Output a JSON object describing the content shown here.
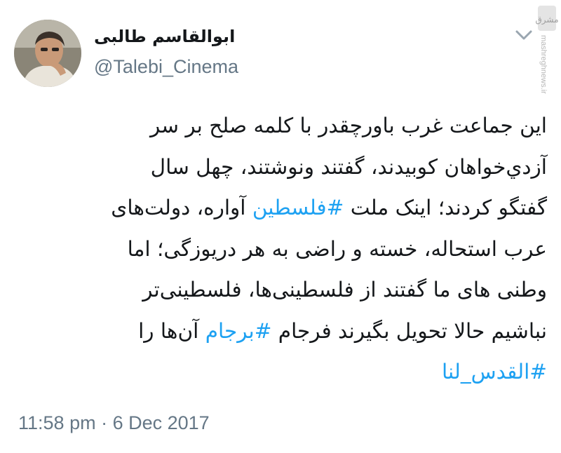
{
  "user": {
    "display_name": "ابوالقاسم طالبی",
    "handle": "@Talebi_Cinema"
  },
  "watermark": {
    "brand": "مشرق",
    "text": "mashreghnews.ir"
  },
  "tweet": {
    "lines": [
      [
        {
          "text": "این جماعت غرب باورچقدر با کلمه صلح بر سر"
        }
      ],
      [
        {
          "text": "آزدي‌خواهان کوبیدند، گفتند ونوشتند، چهل سال"
        }
      ],
      [
        {
          "text": "گفتگو کردند؛ اینک ملت "
        },
        {
          "text": "#فلسطین",
          "hashtag": true
        },
        {
          "text": " آواره، دولت‌های"
        }
      ],
      [
        {
          "text": "عرب استحاله، خسته و راضی به هر دریوزگی؛ اما"
        }
      ],
      [
        {
          "text": "وطنی های ما گفتند از فلسطینی‌ها، فلسطینی‌تر"
        }
      ],
      [
        {
          "text": "نباشیم حالا تحویل بگیرند فرجام "
        },
        {
          "text": "#برجام",
          "hashtag": true
        },
        {
          "text": " آن‌ها را"
        }
      ],
      [
        {
          "text": "#القدس_لنا",
          "hashtag": true
        }
      ]
    ],
    "timestamp": "11:58 pm · 6 Dec 2017"
  },
  "colors": {
    "text": "#14171a",
    "secondary": "#657786",
    "hashtag": "#1da1f2"
  },
  "icons": {
    "caret": "chevron-down-icon",
    "avatar": "avatar"
  }
}
